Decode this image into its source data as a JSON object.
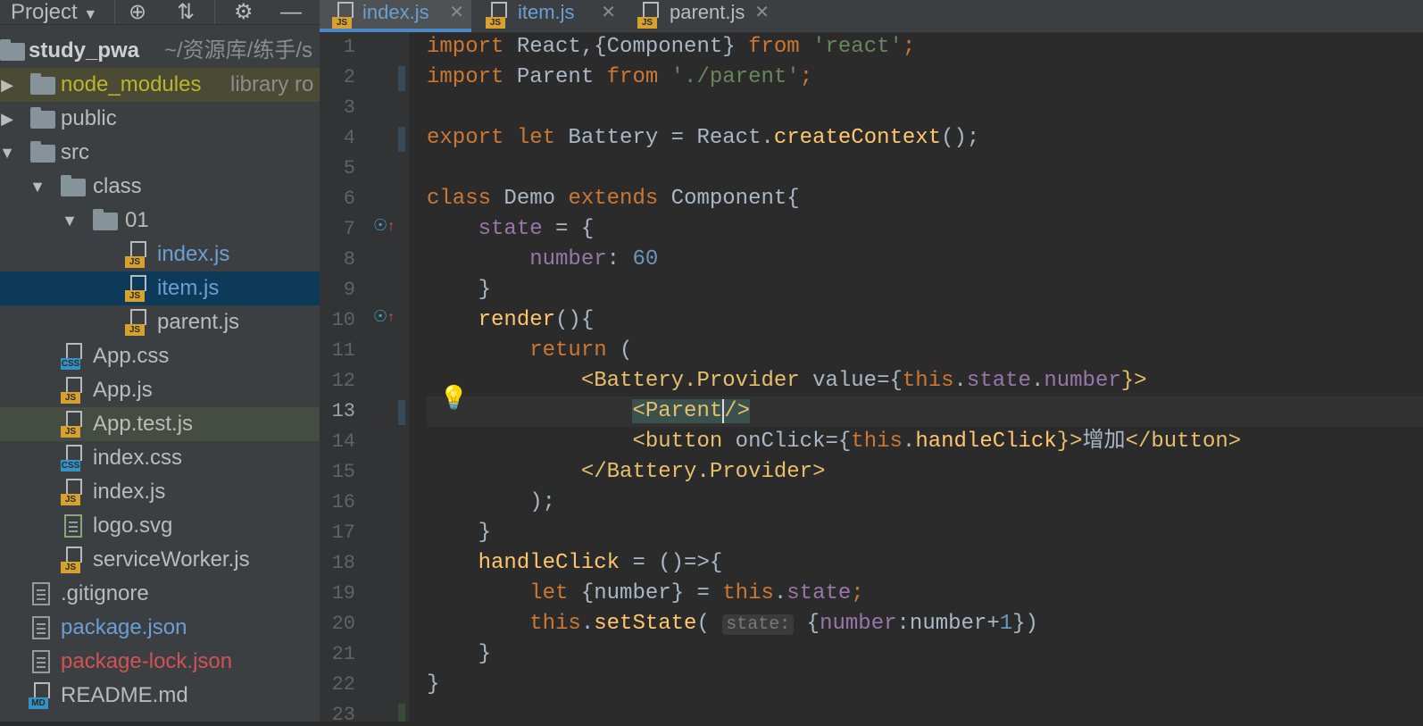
{
  "project_toolbar": {
    "title": "Project",
    "icons": [
      "chevron-down-icon",
      "target-icon",
      "collapse-icon",
      "gear-icon",
      "minimize-icon"
    ]
  },
  "tree": {
    "root": {
      "name": "study_pwa",
      "path": "~/资源库/练手/s"
    },
    "items": [
      {
        "name": "node_modules",
        "suffix": "library ro",
        "type": "folder",
        "color": "#bbb529"
      },
      {
        "name": "public",
        "type": "folder"
      },
      {
        "name": "src",
        "type": "folder"
      },
      {
        "name": "class",
        "type": "folder"
      },
      {
        "name": "01",
        "type": "folder"
      },
      {
        "name": "index.js",
        "type": "js",
        "color": "#6a9fd4"
      },
      {
        "name": "item.js",
        "type": "js",
        "color": "#6a9fd4"
      },
      {
        "name": "parent.js",
        "type": "js"
      },
      {
        "name": "App.css",
        "type": "css"
      },
      {
        "name": "App.js",
        "type": "js"
      },
      {
        "name": "App.test.js",
        "type": "js"
      },
      {
        "name": "index.css",
        "type": "css"
      },
      {
        "name": "index.js",
        "type": "js"
      },
      {
        "name": "logo.svg",
        "type": "svg"
      },
      {
        "name": "serviceWorker.js",
        "type": "js"
      },
      {
        "name": ".gitignore",
        "type": "doc"
      },
      {
        "name": "package.json",
        "type": "json",
        "color": "#6a9fd4"
      },
      {
        "name": "package-lock.json",
        "type": "json",
        "color": "#d25252"
      },
      {
        "name": "README.md",
        "type": "md"
      }
    ]
  },
  "tabs": [
    {
      "label": "index.js",
      "active": true
    },
    {
      "label": "item.js",
      "active": false
    },
    {
      "label": "parent.js",
      "active": false
    }
  ],
  "line_numbers": [
    "1",
    "2",
    "3",
    "4",
    "5",
    "6",
    "7",
    "8",
    "9",
    "10",
    "11",
    "12",
    "13",
    "14",
    "15",
    "16",
    "17",
    "18",
    "19",
    "20",
    "21",
    "22",
    "23"
  ],
  "code": {
    "l1": [
      "import",
      " React,{Component} ",
      "from",
      " 'react'",
      ";"
    ],
    "l2": [
      "import",
      " Parent ",
      "from",
      " './parent'",
      ";"
    ],
    "l4": [
      "export",
      " let",
      " Battery = React.",
      "createContext",
      "();"
    ],
    "l6": [
      "class",
      " Demo ",
      "extends",
      " Component{"
    ],
    "l7": [
      "state",
      " = {"
    ],
    "l8": [
      "number",
      ": ",
      "60"
    ],
    "l9": [
      "}"
    ],
    "l10": [
      "render",
      "(){"
    ],
    "l11": [
      "return",
      " ("
    ],
    "l12": [
      "<Battery.Provider",
      " value",
      "={",
      "this",
      ".",
      "state",
      ".",
      "number",
      "}>"
    ],
    "l13": [
      "<Parent",
      "/>"
    ],
    "l14": [
      "<button",
      " onClick",
      "={",
      "this",
      ".",
      "handleClick",
      "}>",
      "增加",
      "</button>"
    ],
    "l15": [
      "</Battery.Provider>"
    ],
    "l16": [
      ");"
    ],
    "l17": [
      "}"
    ],
    "l18": [
      "handleClick",
      " = ()=>{"
    ],
    "l19": [
      "let",
      " {number} = ",
      "this",
      ".",
      "state",
      ";"
    ],
    "l20": [
      "this",
      ".",
      "setState",
      "( ",
      "state:",
      " {",
      "number",
      ":number+",
      "1",
      "})"
    ],
    "l21": [
      "}"
    ],
    "l22": [
      "}"
    ]
  },
  "colors": {
    "keyword": "#cc7832",
    "string": "#6a8759",
    "number": "#6897bb",
    "function": "#ffc66d",
    "property": "#9876aa",
    "tag": "#e8bf6a",
    "text": "#a9b7c6"
  }
}
